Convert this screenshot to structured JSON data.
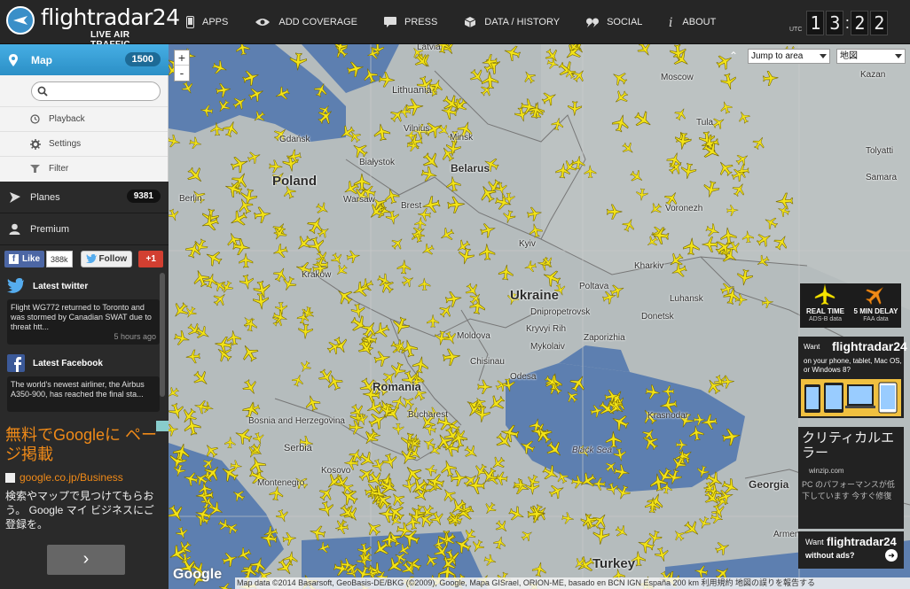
{
  "header": {
    "logo": "flightradar24",
    "tagline": "LIVE AIR TRAFFIC",
    "nav": [
      {
        "label": "APPS",
        "icon": "phone-icon"
      },
      {
        "label": "ADD COVERAGE",
        "icon": "eye-icon"
      },
      {
        "label": "PRESS",
        "icon": "speech-bubble-icon"
      },
      {
        "label": "DATA / HISTORY",
        "icon": "box-icon"
      },
      {
        "label": "SOCIAL",
        "icon": "quote-icon"
      },
      {
        "label": "ABOUT",
        "icon": "info-icon"
      }
    ],
    "clock": {
      "utc": "UTC",
      "h1": "1",
      "h2": "3",
      "m1": "2",
      "m2": "2",
      "sep": ":"
    }
  },
  "sidebar": {
    "map": {
      "label": "Map",
      "count": "1500"
    },
    "search": {
      "placeholder": ""
    },
    "sub_items": [
      {
        "label": "Playback",
        "icon": "clock-icon"
      },
      {
        "label": "Settings",
        "icon": "gear-icon"
      },
      {
        "label": "Filter",
        "icon": "funnel-icon"
      }
    ],
    "planes": {
      "label": "Planes",
      "count": "9381"
    },
    "premium": {
      "label": "Premium"
    },
    "social": {
      "fb_like": "Like",
      "fb_count": "388k",
      "tw_follow": "Follow",
      "gplus": "+1"
    },
    "twitter": {
      "title": "Latest twitter",
      "text": "Flight WG772 returned to Toronto and was stormed by Canadian SWAT due to threat htt...",
      "ago": "5 hours ago"
    },
    "facebook": {
      "title": "Latest Facebook",
      "text": "The world's newest airliner, the Airbus A350-900, has reached the final sta..."
    },
    "ad": {
      "title": "無料でGoogleに ページ掲載",
      "url": "google.co.jp/Business",
      "text": "検索やマップで見つけてもらおう。 Google マイ ビジネスにご登録を。",
      "button": "›"
    }
  },
  "map": {
    "controls": {
      "zoom_in": "+",
      "zoom_out": "-",
      "jump": "Jump to area",
      "maptype": "地図",
      "collapse": "⌃"
    },
    "labels": {
      "latvia": "Latvia",
      "lithuania": "Lithuania",
      "moscow": "Moscow",
      "kazan": "Kazan",
      "vilnius": "Vilnius",
      "minsk": "Minsk",
      "gdansk": "Gdańsk",
      "belarus": "Belarus",
      "bialystok": "Białystok",
      "poland": "Poland",
      "warsaw": "Warsaw",
      "berlin": "Berlin",
      "brest": "Brest",
      "tula": "Tula",
      "tolyatti": "Tolyatti",
      "samara": "Samara",
      "voronezh": "Voronezh",
      "kyiv": "Kyiv",
      "kharkiv": "Kharkiv",
      "krakow": "Kraków",
      "ukraine": "Ukraine",
      "poltava": "Poltava",
      "luhansk": "Luhansk",
      "dnipro": "Dnipropetrovsk",
      "donetsk": "Donetsk",
      "kryvyi": "Kryvyi Rih",
      "zaporizhia": "Zaporizhia",
      "moldova": "Moldova",
      "mykolaiv": "Mykolaiv",
      "chisinau": "Chisinau",
      "odesa": "Odesa",
      "romania": "Romania",
      "krasnodar": "Krasnodar",
      "bucharest": "Bucharest",
      "blacksea": "Black Sea",
      "georgia": "Georgia",
      "bosnia": "Bosnia and Herzegovina",
      "serbia": "Serbia",
      "kosovo": "Kosovo",
      "montenegro": "Montenegro",
      "turkey": "Turkey",
      "armenia": "Armen"
    },
    "legend": {
      "rt_title": "REAL TIME",
      "rt_sub": "ADS-B data",
      "delay_title": "5 MIN DELAY",
      "delay_sub": "FAA data"
    },
    "promo1": {
      "want": "Want",
      "brand": "flightradar24",
      "lines": "on your phone, tablet, Mac OS, or Windows 8?"
    },
    "promo2": {
      "title": "クリティカルエラー",
      "url": "winzip.com",
      "desc": "PC のパフォーマンスが低下しています 今すぐ修復"
    },
    "promo3": {
      "want": "Want",
      "brand": "flightradar24",
      "no_ads": "without ads?",
      "arrow": "➜"
    },
    "attribution": "Map data ©2014 Basarsoft, GeoBasis-DE/BKG (©2009), Google, Mapa GISrael, ORION-ME, basado en BCN IGN España   200 km   利用規約   地図の誤りを報告する",
    "google": "Google"
  }
}
